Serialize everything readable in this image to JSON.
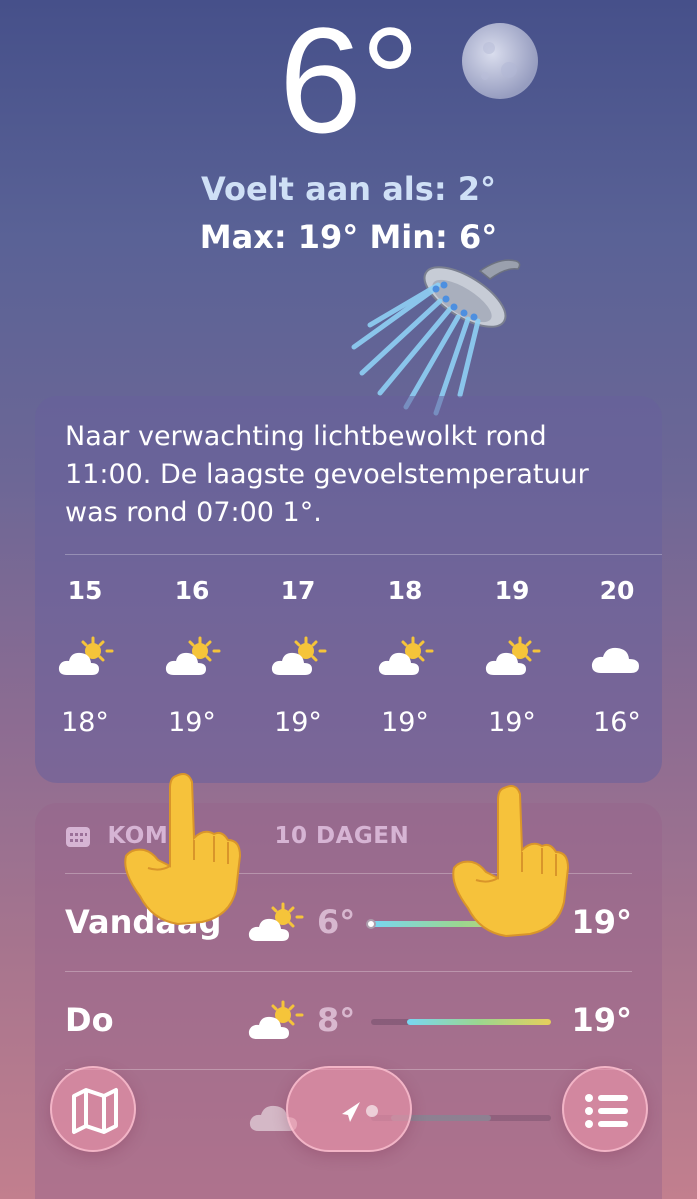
{
  "current": {
    "temperature": "6°",
    "feels_like": "Voelt aan als: 2°",
    "max_min": "Max: 19°  Min: 6°"
  },
  "hourly": {
    "summary": "Naar verwachting lichtbewolkt rond 11:00. De laagste gevoelstemperatuur was rond 07:00 1°.",
    "hours": [
      {
        "time": "15",
        "icon": "partly-sunny-icon",
        "temp": "18°"
      },
      {
        "time": "16",
        "icon": "partly-sunny-icon",
        "temp": "19°"
      },
      {
        "time": "17",
        "icon": "partly-sunny-icon",
        "temp": "19°"
      },
      {
        "time": "18",
        "icon": "partly-sunny-icon",
        "temp": "19°"
      },
      {
        "time": "19",
        "icon": "partly-sunny-icon",
        "temp": "19°"
      },
      {
        "time": "20",
        "icon": "cloud-icon",
        "temp": "16°"
      }
    ]
  },
  "daily": {
    "header_visible": [
      "KOME",
      "10 DAGEN"
    ],
    "days": [
      {
        "name": "Vandaag",
        "icon": "partly-sunny-icon",
        "low": "6°",
        "high": "19°",
        "range_start": 0.0,
        "range_end": 1.0,
        "current_marker": 0.0
      },
      {
        "name": "Do",
        "icon": "partly-sunny-icon",
        "low": "8°",
        "high": "19°",
        "range_start": 0.2,
        "range_end": 1.0
      }
    ]
  },
  "toolbar": {
    "map_icon": "map-icon",
    "location_icon": "location-arrow-icon",
    "list_icon": "list-icon"
  },
  "overlays": [
    "shower-emoji",
    "pointing-up-hand-left",
    "pointing-up-hand-right"
  ],
  "colors": {
    "feels_like_text": "#cfe0f6",
    "range_gradient": [
      "#78d6f2",
      "#9bd68f",
      "#e6cf5c"
    ],
    "sun": "#f5c43a"
  }
}
